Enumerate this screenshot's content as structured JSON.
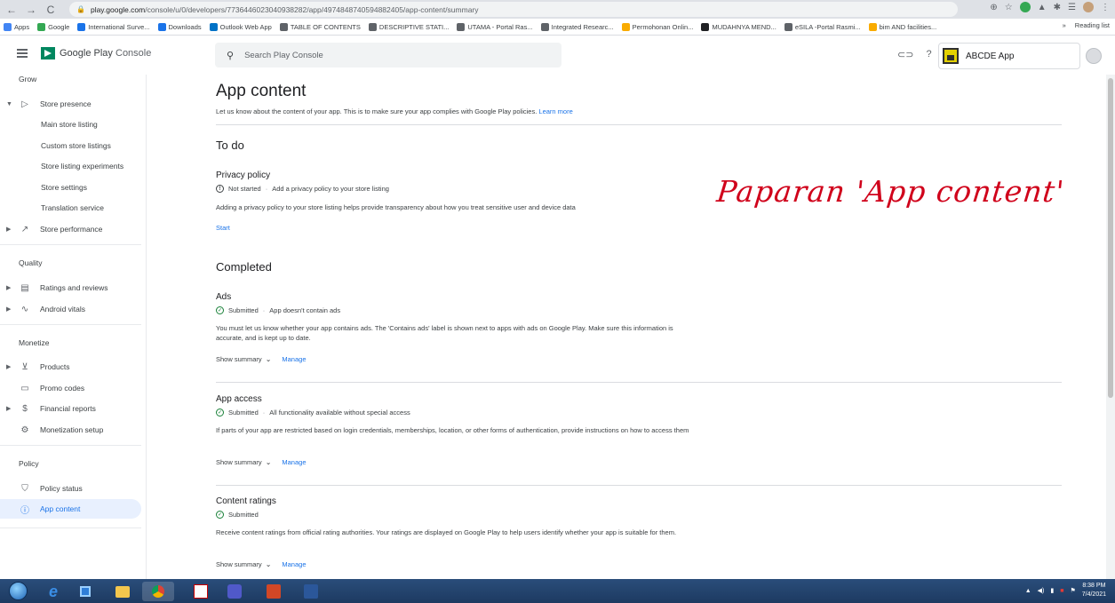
{
  "browser": {
    "url_host": "play.google.com",
    "url_path": "/console/u/0/developers/7736446023040938282/app/4974848740594882405/app-content/summary",
    "bookmarks": [
      {
        "label": "Apps",
        "color": "#4285f4"
      },
      {
        "label": "Google",
        "color": "#34a853"
      },
      {
        "label": "International Surve...",
        "color": "#1a73e8"
      },
      {
        "label": "Downloads",
        "color": "#1a73e8"
      },
      {
        "label": "Outlook Web App",
        "color": "#0072c6"
      },
      {
        "label": "TABLE OF CONTENTS",
        "color": "#5f6368"
      },
      {
        "label": "DESCRIPTIVE STATI...",
        "color": "#5f6368"
      },
      {
        "label": "UTAMA - Portal Ras...",
        "color": "#5f6368"
      },
      {
        "label": "Integrated Researc...",
        "color": "#5f6368"
      },
      {
        "label": "Permohonan Onlin...",
        "color": "#f9ab00"
      },
      {
        "label": "MUDAHNYA MEND...",
        "color": "#202124"
      },
      {
        "label": "eSILA -Portal Rasmi...",
        "color": "#5f6368"
      },
      {
        "label": "bim AND facilities...",
        "color": "#f9ab00"
      }
    ],
    "reading_list": "Reading list",
    "more": "»"
  },
  "header": {
    "brand": "Google Play",
    "brand_sub": "Console",
    "search_placeholder": "Search Play Console",
    "app_name": "ABCDE App"
  },
  "sidebar": {
    "sections": {
      "grow": "Grow",
      "quality": "Quality",
      "monetize": "Monetize",
      "policy": "Policy"
    },
    "items": {
      "store_presence": "Store presence",
      "main_store_listing": "Main store listing",
      "custom_store_listings": "Custom store listings",
      "store_listing_experiments": "Store listing experiments",
      "store_settings": "Store settings",
      "translation_service": "Translation service",
      "store_performance": "Store performance",
      "ratings_reviews": "Ratings and reviews",
      "android_vitals": "Android vitals",
      "products": "Products",
      "promo_codes": "Promo codes",
      "financial_reports": "Financial reports",
      "monetization_setup": "Monetization setup",
      "policy_status": "Policy status",
      "app_content": "App content"
    }
  },
  "main": {
    "title": "App content",
    "intro": "Let us know about the content of your app. This is to make sure your app complies with Google Play policies.",
    "learn_more": "Learn more",
    "todo_title": "To do",
    "completed_title": "Completed",
    "privacy": {
      "title": "Privacy policy",
      "status": "Not started",
      "status_detail": "Add a privacy policy to your store listing",
      "desc": "Adding a privacy policy to your store listing helps provide transparency about how you treat sensitive user and device data",
      "action": "Start"
    },
    "ads": {
      "title": "Ads",
      "status": "Submitted",
      "status_detail": "App doesn't contain ads",
      "desc": "You must let us know whether your app contains ads. The 'Contains ads' label is shown next to apps with ads on Google Play. Make sure this information is accurate, and is kept up to date."
    },
    "app_access": {
      "title": "App access",
      "status": "Submitted",
      "status_detail": "All functionality available without special access",
      "desc": "If parts of your app are restricted based on login credentials, memberships, location, or other forms of authentication, provide instructions on how to access them"
    },
    "content_ratings": {
      "title": "Content ratings",
      "status": "Submitted",
      "desc": "Receive content ratings from official rating authorities. Your ratings are displayed on Google Play to help users identify whether your app is suitable for them."
    },
    "show_summary": "Show summary",
    "manage": "Manage",
    "dot": "·"
  },
  "annotation": "Paparan 'App content'",
  "taskbar": {
    "time": "8:38 PM",
    "date": "7/4/2021"
  }
}
